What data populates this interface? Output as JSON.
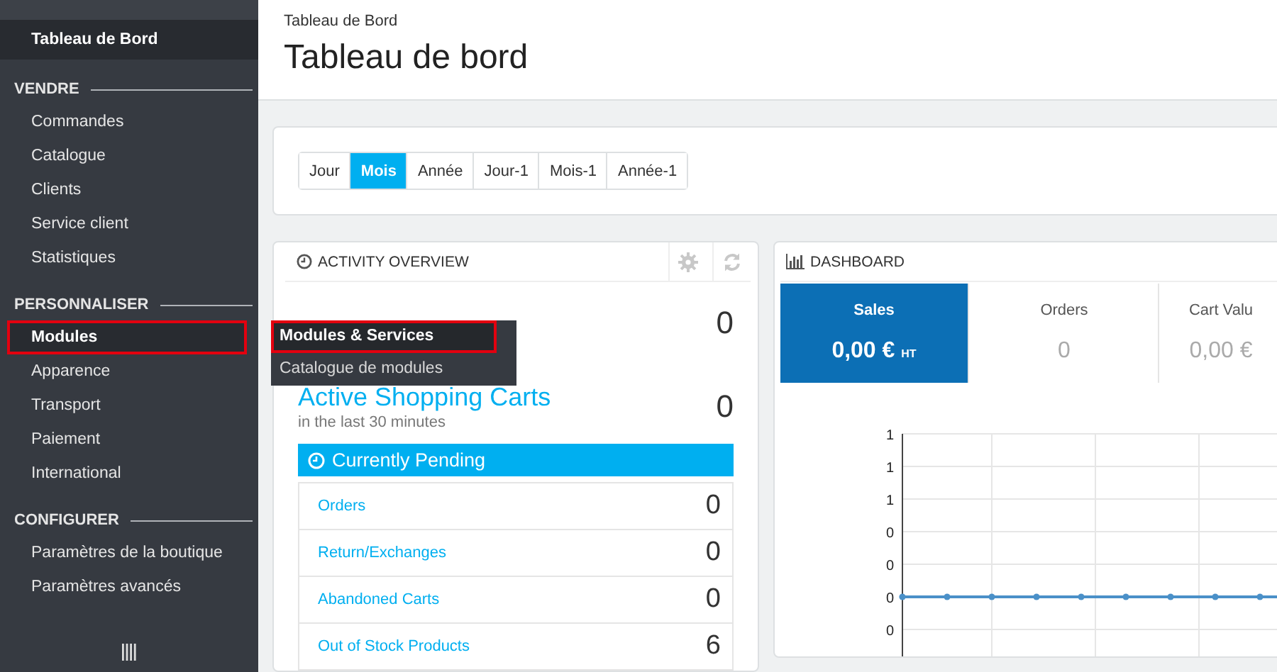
{
  "sidebar": {
    "top_item": {
      "label": "Tableau de Bord"
    },
    "sections": [
      {
        "title": "VENDRE",
        "items": [
          {
            "label": "Commandes",
            "selected": false,
            "highlighted": false
          },
          {
            "label": "Catalogue",
            "selected": false,
            "highlighted": false
          },
          {
            "label": "Clients",
            "selected": false,
            "highlighted": false
          },
          {
            "label": "Service client",
            "selected": false,
            "highlighted": false
          },
          {
            "label": "Statistiques",
            "selected": false,
            "highlighted": false
          }
        ]
      },
      {
        "title": "PERSONNALISER",
        "items": [
          {
            "label": "Modules",
            "selected": true,
            "highlighted": true,
            "submenu": [
              {
                "label": "Modules & Services",
                "selected": true,
                "highlighted": true
              },
              {
                "label": "Catalogue de modules",
                "selected": false,
                "highlighted": false
              }
            ]
          },
          {
            "label": "Apparence",
            "selected": false,
            "highlighted": false
          },
          {
            "label": "Transport",
            "selected": false,
            "highlighted": false
          },
          {
            "label": "Paiement",
            "selected": false,
            "highlighted": false
          },
          {
            "label": "International",
            "selected": false,
            "highlighted": false
          }
        ]
      },
      {
        "title": "CONFIGURER",
        "items": [
          {
            "label": "Paramètres de la boutique",
            "selected": false,
            "highlighted": false
          },
          {
            "label": "Paramètres avancés",
            "selected": false,
            "highlighted": false
          }
        ]
      }
    ]
  },
  "header": {
    "breadcrumb": "Tableau de Bord",
    "title": "Tableau de bord"
  },
  "period_filter": [
    {
      "label": "Jour",
      "selected": false
    },
    {
      "label": "Mois",
      "selected": true
    },
    {
      "label": "Année",
      "selected": false
    },
    {
      "label": "Jour-1",
      "selected": false
    },
    {
      "label": "Mois-1",
      "selected": false
    },
    {
      "label": "Année-1",
      "selected": false
    }
  ],
  "activity_overview": {
    "title": "ACTIVITY OVERVIEW",
    "first_value": "0",
    "carts": {
      "label": "Active Shopping Carts",
      "value": "0",
      "note": "in the last 30 minutes"
    },
    "pending": {
      "title": "Currently Pending",
      "items": [
        {
          "label": "Orders",
          "value": "0"
        },
        {
          "label": "Return/Exchanges",
          "value": "0"
        },
        {
          "label": "Abandoned Carts",
          "value": "0"
        },
        {
          "label": "Out of Stock Products",
          "value": "6"
        }
      ]
    }
  },
  "dashboard": {
    "title": "DASHBOARD",
    "kpis": [
      {
        "label": "Sales",
        "value": "0,00 €",
        "unit": "HT",
        "selected": true
      },
      {
        "label": "Orders",
        "value": "0",
        "selected": false
      },
      {
        "label": "Cart Valu",
        "value": "0,00 €",
        "selected": false
      }
    ],
    "chart": {
      "y_axis_labels": [
        "1",
        "1",
        "1",
        "0",
        "0",
        "0",
        "0"
      ]
    }
  }
}
